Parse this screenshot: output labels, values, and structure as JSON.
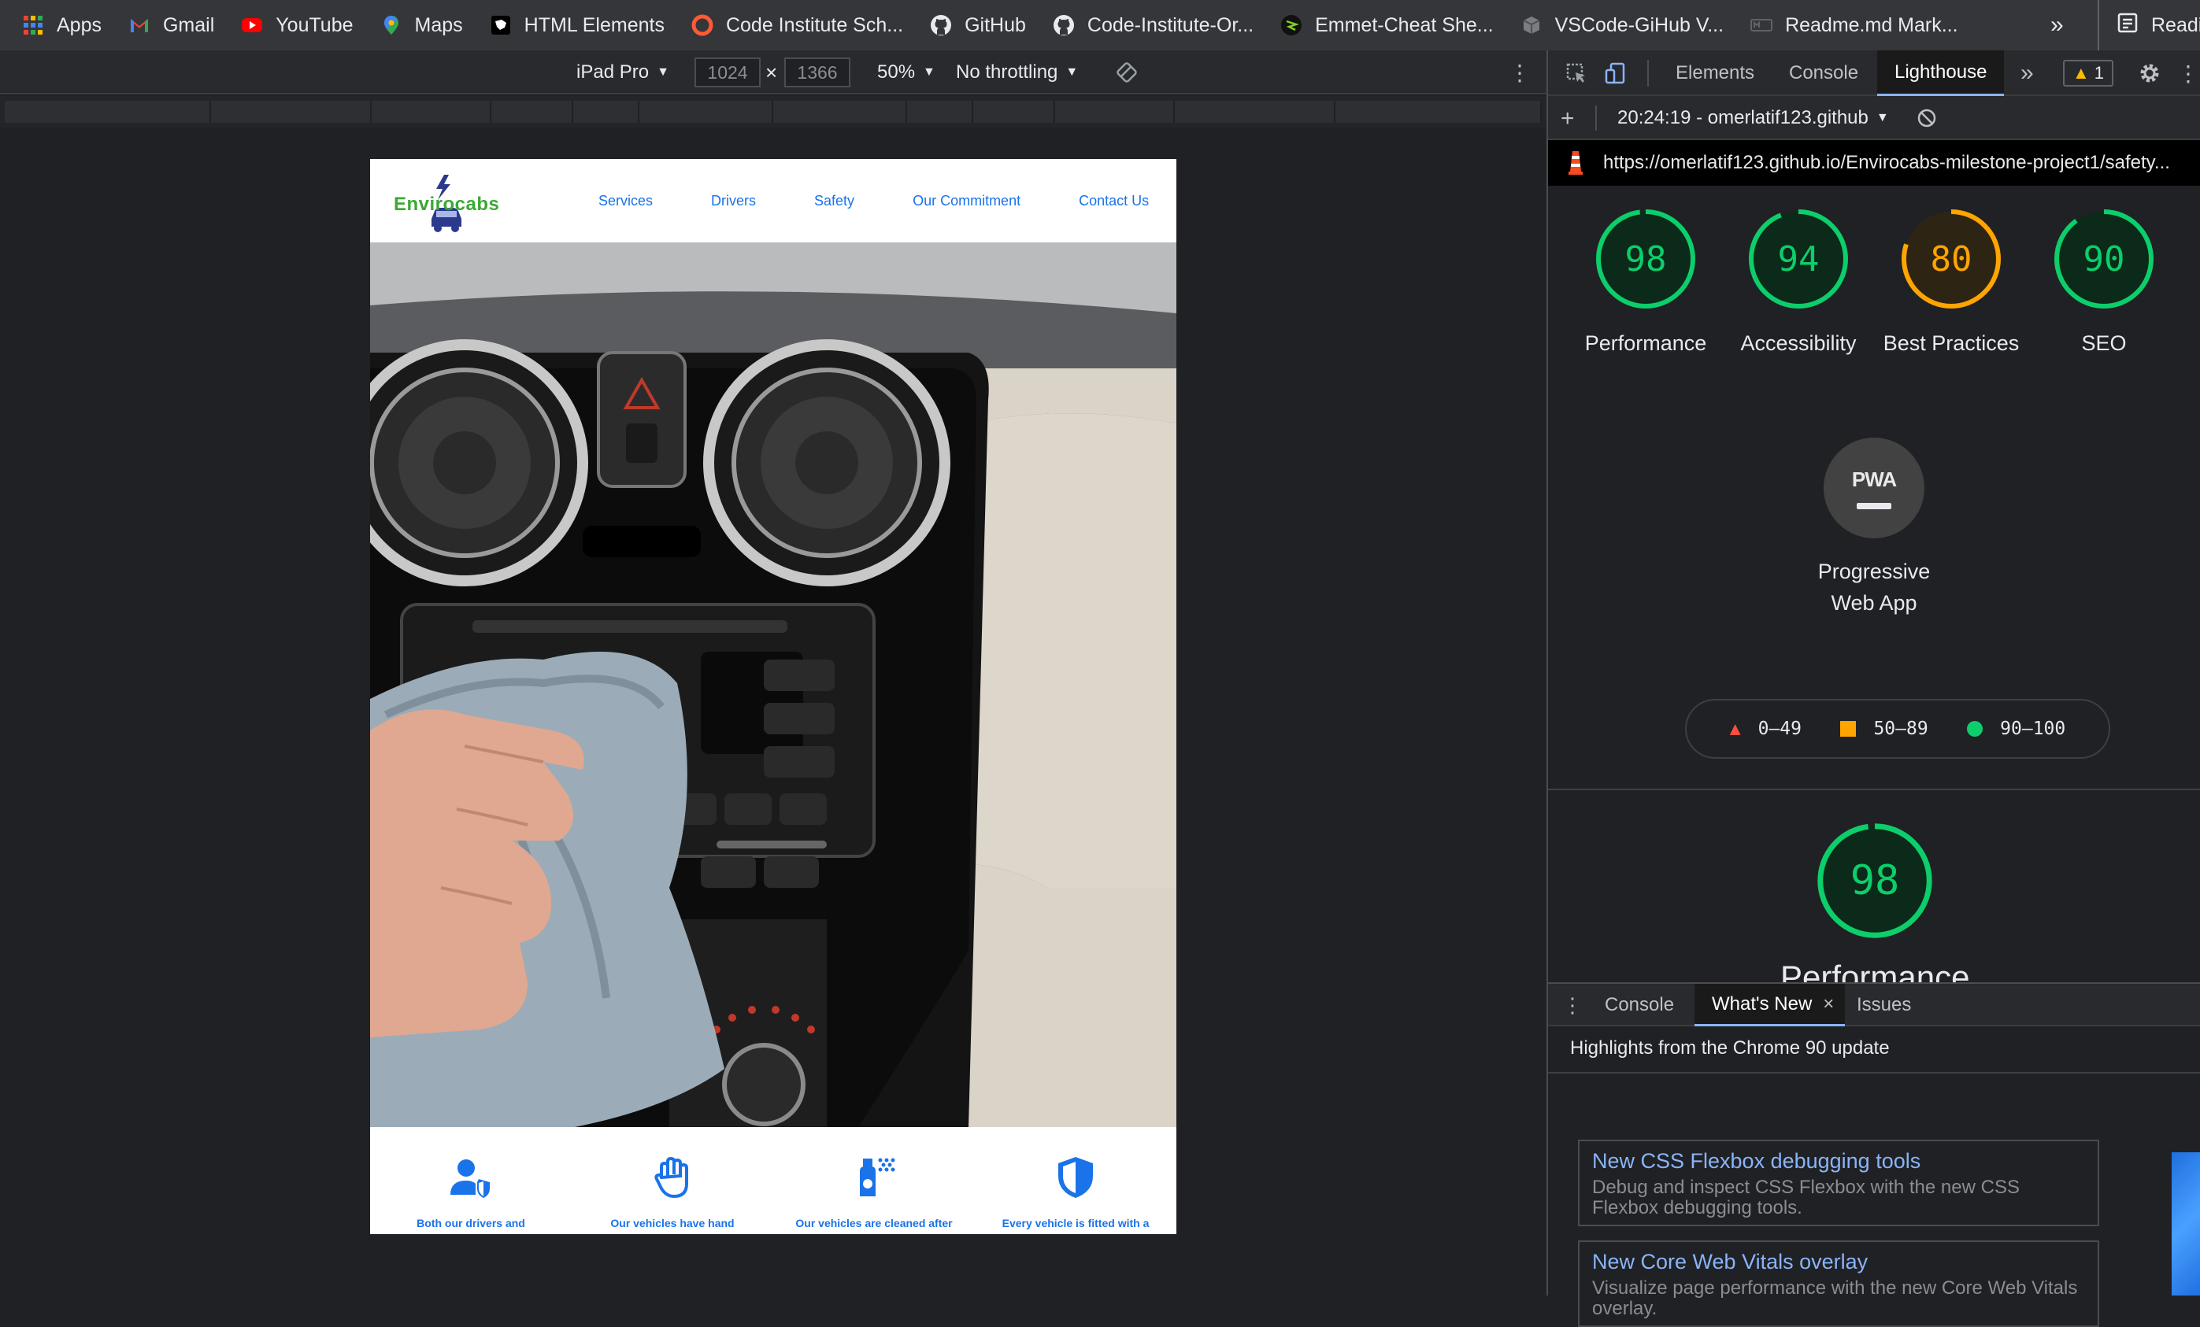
{
  "bookmarks": [
    {
      "label": "Apps",
      "icon": "apps-grid-icon"
    },
    {
      "label": "Gmail",
      "icon": "gmail-icon"
    },
    {
      "label": "YouTube",
      "icon": "youtube-icon"
    },
    {
      "label": "Maps",
      "icon": "maps-icon"
    },
    {
      "label": "HTML Elements",
      "icon": "html-elements-icon"
    },
    {
      "label": "Code Institute Sch...",
      "icon": "code-institute-icon"
    },
    {
      "label": "GitHub",
      "icon": "github-icon"
    },
    {
      "label": "Code-Institute-Or...",
      "icon": "github-icon"
    },
    {
      "label": "Emmet-Cheat She...",
      "icon": "emmet-icon"
    },
    {
      "label": "VSCode-GiHub V...",
      "icon": "vscode-icon"
    },
    {
      "label": "Readme.md Mark...",
      "icon": "markdown-icon"
    }
  ],
  "bookmarks_more": "»",
  "reading_list_label": "Reading",
  "device_toolbar": {
    "device": "iPad Pro",
    "width": "1024",
    "times": "×",
    "height": "1366",
    "zoom": "50%",
    "throttling": "No throttling"
  },
  "site": {
    "logo_text": "Envirocabs",
    "nav": [
      "Services",
      "Drivers",
      "Safety",
      "Our Commitment",
      "Contact Us"
    ],
    "features": [
      "Both our drivers and",
      "Our vehicles have hand",
      "Our vehicles are cleaned after",
      "Every vehicle is fitted with a"
    ]
  },
  "devtools": {
    "tabs": [
      "Elements",
      "Console",
      "Lighthouse"
    ],
    "more_tabs": "»",
    "warning_count": "1",
    "report_time": "20:24:19 - omerlatif123.github",
    "report_url": "https://omerlatif123.github.io/Envirocabs-milestone-project1/safety...",
    "scores": [
      {
        "value": "98",
        "label": "Performance",
        "color": "#0cce6b"
      },
      {
        "value": "94",
        "label": "Accessibility",
        "color": "#0cce6b"
      },
      {
        "value": "80",
        "label": "Best Practices",
        "color": "#ffa400"
      },
      {
        "value": "90",
        "label": "SEO",
        "color": "#0cce6b"
      }
    ],
    "pwa_badge": "PWA",
    "pwa_label": "Progressive Web App",
    "legend": [
      {
        "range": "0–49",
        "color": "#ff4e42"
      },
      {
        "range": "50–89",
        "color": "#ffa400"
      },
      {
        "range": "90–100",
        "color": "#0cce6b"
      }
    ],
    "detail_score": "98",
    "detail_label": "Performance",
    "drawer_tabs": [
      "Console",
      "What's New",
      "Issues"
    ],
    "drawer_close": "×",
    "drawer_heading": "Highlights from the Chrome 90 update",
    "cards": [
      {
        "title": "New CSS Flexbox debugging tools",
        "desc": "Debug and inspect CSS Flexbox with the new CSS Flexbox debugging tools."
      },
      {
        "title": "New Core Web Vitals overlay",
        "desc": "Visualize page performance with the new Core Web Vitals overlay."
      }
    ]
  }
}
